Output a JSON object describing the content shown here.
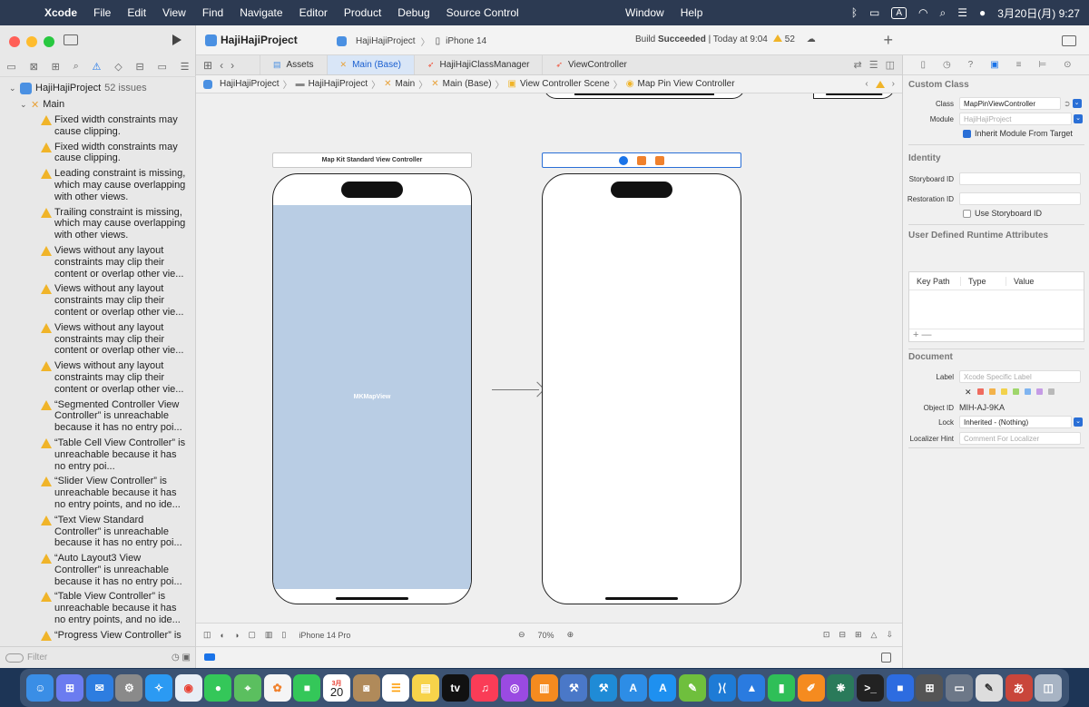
{
  "menubar": {
    "app_name": "Xcode",
    "items": [
      "File",
      "Edit",
      "View",
      "Find",
      "Navigate",
      "Editor",
      "Product",
      "Debug",
      "Source Control"
    ],
    "center_items": [
      "Window",
      "Help"
    ],
    "input_badge": "A",
    "datetime": "3月20日(月) 9:27"
  },
  "toolbar": {
    "project_name": "HajiHajiProject",
    "scheme": "HajiHajiProject",
    "device": "iPhone 14",
    "status_prefix": "Build ",
    "status_bold": "Succeeded",
    "status_suffix": " | Today at 9:04",
    "warning_count": "52"
  },
  "navigator": {
    "root_label": "HajiHajiProject",
    "root_count": "52 issues",
    "group_label": "Main",
    "issues": [
      "Fixed width constraints may cause clipping.",
      "Fixed width constraints may cause clipping.",
      "Leading constraint is missing, which may cause overlapping with other views.",
      "Trailing constraint is missing, which may cause overlapping with other views.",
      "Views without any layout constraints may clip their content or overlap other vie...",
      "Views without any layout constraints may clip their content or overlap other vie...",
      "Views without any layout constraints may clip their content or overlap other vie...",
      "Views without any layout constraints may clip their content or overlap other vie...",
      "“Segmented Controller View Controller” is unreachable because it has no entry poi...",
      "“Table Cell View Controller” is unreachable because it has no entry poi...",
      "“Slider View Controller” is unreachable because it has no entry points, and no ide...",
      "“Text View Standard Controller” is unreachable because it has no entry poi...",
      "“Auto Layout3 View Controller” is unreachable because it has no entry poi...",
      "“Table View Controller” is unreachable because it has no entry points, and no ide...",
      "“Progress View Controller” is"
    ],
    "filter_placeholder": "Filter"
  },
  "tabs": [
    {
      "label": "Assets",
      "icon": "asset-catalog-icon",
      "active": false
    },
    {
      "label": "Main (Base)",
      "icon": "storyboard-icon",
      "active": true
    },
    {
      "label": "HajiHajiClassManager",
      "icon": "swift-icon",
      "active": false
    },
    {
      "label": "ViewController",
      "icon": "swift-icon",
      "active": false
    }
  ],
  "jumpbar": [
    "HajiHajiProject",
    "HajiHajiProject",
    "Main",
    "Main (Base)",
    "View Controller Scene",
    "Map Pin View Controller"
  ],
  "canvas": {
    "scene1_title": "Map Kit Standard View Controller",
    "mapview_label": "MKMapView",
    "device_label": "iPhone 14 Pro",
    "zoom_level": "70%"
  },
  "inspector": {
    "custom_class_title": "Custom Class",
    "class_label": "Class",
    "class_value": "MapPinViewController",
    "module_label": "Module",
    "module_placeholder": "HajiHajiProject",
    "inherit_label": "Inherit Module From Target",
    "identity_title": "Identity",
    "storyboard_id_label": "Storyboard ID",
    "restoration_id_label": "Restoration ID",
    "use_storyboard_id_label": "Use Storyboard ID",
    "runtime_attrs_title": "User Defined Runtime Attributes",
    "col_key_path": "Key Path",
    "col_type": "Type",
    "col_value": "Value",
    "add_remove": "+ —",
    "document_title": "Document",
    "label_label": "Label",
    "label_placeholder": "Xcode Specific Label",
    "object_id_label": "Object ID",
    "object_id_value": "MIH-AJ-9KA",
    "lock_label": "Lock",
    "lock_value": "Inherited - (Nothing)",
    "localizer_label": "Localizer Hint",
    "localizer_placeholder": "Comment For Localizer",
    "label_colors": [
      "#ef6b5e",
      "#f3b24a",
      "#f2d24c",
      "#9fd66b",
      "#7fb4f0",
      "#c59be5",
      "#b9b9b9"
    ]
  },
  "dock": {
    "calendar_month": "3月",
    "calendar_day": "20"
  },
  "colors": {
    "accent": "#1a73e8",
    "warning": "#f0b429",
    "mapview_fill": "#b9cde4"
  }
}
